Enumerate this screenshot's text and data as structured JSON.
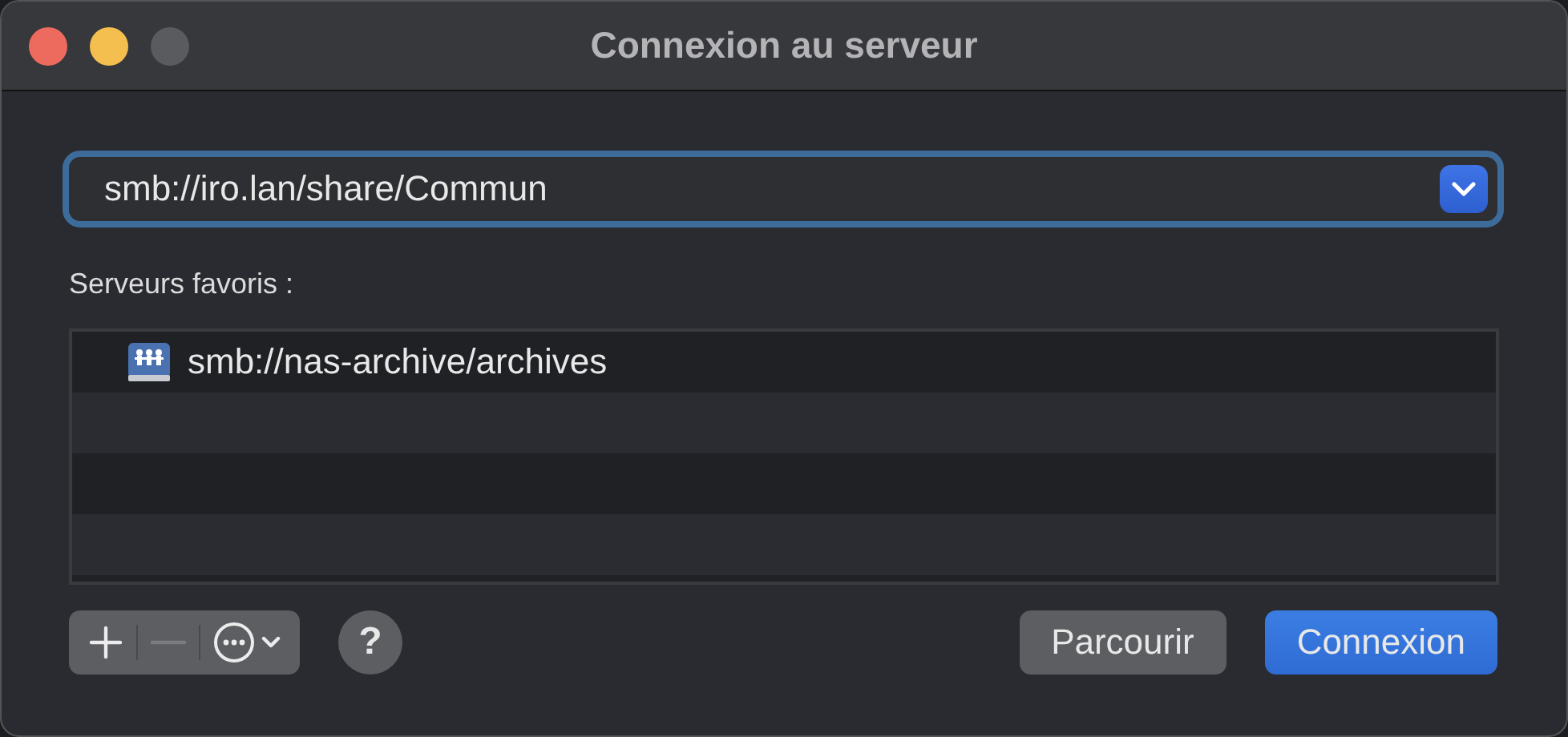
{
  "window": {
    "title": "Connexion au serveur"
  },
  "address": {
    "value": "smb://iro.lan/share/Commun",
    "focused": true
  },
  "favorites_label": "Serveurs favoris :",
  "favorites": [
    {
      "label": "smb://nas-archive/archives"
    }
  ],
  "toolbar": [
    {
      "kind": "add",
      "disabled": false
    },
    {
      "kind": "remove",
      "disabled": true
    },
    {
      "kind": "more",
      "disabled": false
    }
  ],
  "help": "?",
  "buttons": [
    {
      "label": "Parcourir",
      "default": false
    },
    {
      "label": "Connexion",
      "default": true
    }
  ]
}
